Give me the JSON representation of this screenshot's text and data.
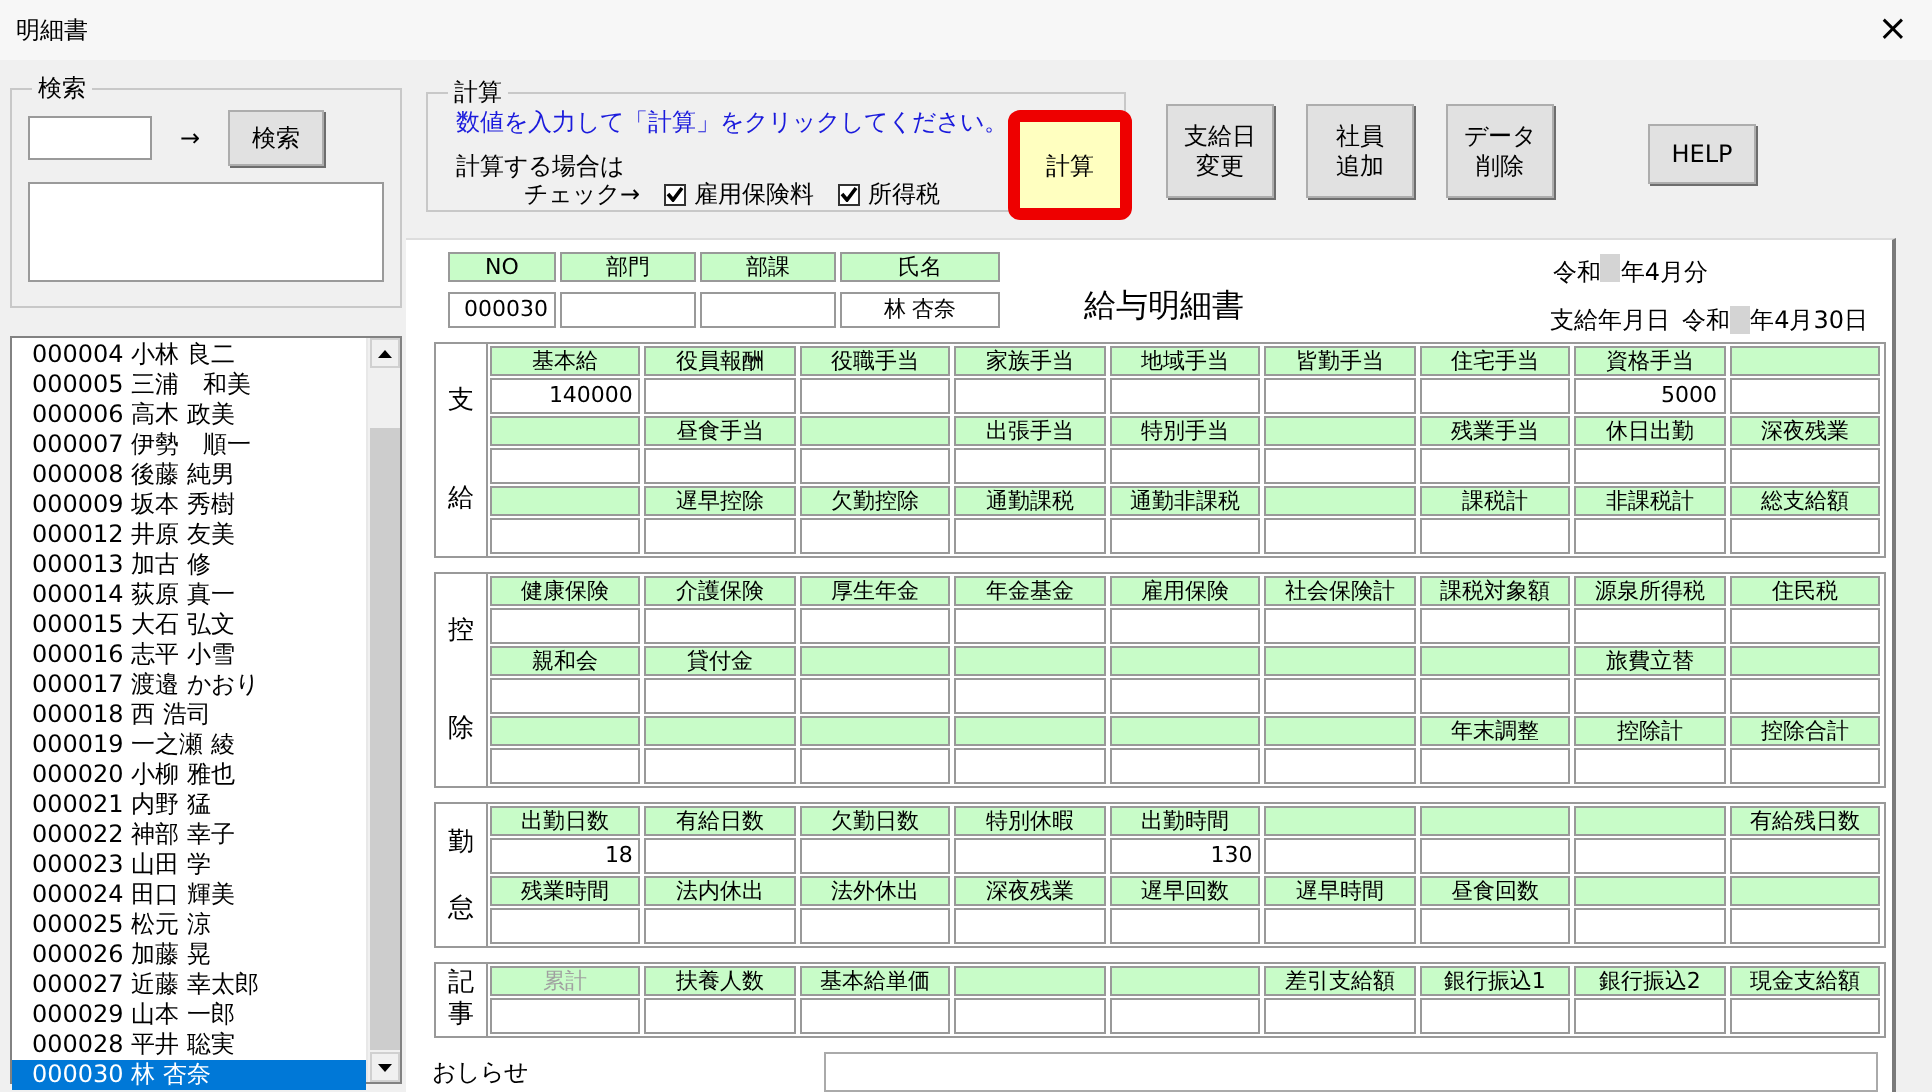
{
  "window": {
    "title": "明細書",
    "close": "×"
  },
  "search": {
    "title": "検索",
    "arrow": "→",
    "button": "検索"
  },
  "employee_list": {
    "items": [
      {
        "label": "000004 小林 良二",
        "selected": false
      },
      {
        "label": "000005 三浦　和美",
        "selected": false
      },
      {
        "label": "000006 高木 政美",
        "selected": false
      },
      {
        "label": "000007 伊勢　順一",
        "selected": false
      },
      {
        "label": "000008 後藤 純男",
        "selected": false
      },
      {
        "label": "000009 坂本 秀樹",
        "selected": false
      },
      {
        "label": "000012 井原 友美",
        "selected": false
      },
      {
        "label": "000013 加古 修",
        "selected": false
      },
      {
        "label": "000014 荻原 真一",
        "selected": false
      },
      {
        "label": "000015 大石 弘文",
        "selected": false
      },
      {
        "label": "000016 志平 小雪",
        "selected": false
      },
      {
        "label": "000017 渡邉 かおり",
        "selected": false
      },
      {
        "label": "000018 西 浩司",
        "selected": false
      },
      {
        "label": "000019 一之瀬 綾",
        "selected": false
      },
      {
        "label": "000020 小柳 雅也",
        "selected": false
      },
      {
        "label": "000021 内野 猛",
        "selected": false
      },
      {
        "label": "000022 神部 幸子",
        "selected": false
      },
      {
        "label": "000023 山田 学",
        "selected": false
      },
      {
        "label": "000024 田口 輝美",
        "selected": false
      },
      {
        "label": "000025 松元 涼",
        "selected": false
      },
      {
        "label": "000026 加藤 晃",
        "selected": false
      },
      {
        "label": "000027 近藤 幸太郎",
        "selected": false
      },
      {
        "label": "000029 山本 一郎",
        "selected": false
      },
      {
        "label": "000028 平井 聡実",
        "selected": false
      },
      {
        "label": "000030 林 杏奈",
        "selected": true
      }
    ]
  },
  "calculation": {
    "title": "計算",
    "instruction": "数値を入力して「計算」をクリックしてください。",
    "prompt_line1": "計算する場合は",
    "prompt_line2": "チェック→",
    "options": [
      {
        "label": "雇用保険料",
        "checked": true
      },
      {
        "label": "所得税",
        "checked": true
      }
    ],
    "button": "計算"
  },
  "toolbar_buttons": [
    {
      "lines": [
        "支給日",
        "変更"
      ]
    },
    {
      "lines": [
        "社員",
        "追加"
      ]
    },
    {
      "lines": [
        "データ",
        "削除"
      ]
    },
    {
      "lines": [
        "HELP"
      ]
    }
  ],
  "header": {
    "columns": [
      {
        "label": "NO",
        "value": "000030"
      },
      {
        "label": "部門"
      },
      {
        "label": "部課"
      },
      {
        "label": "氏名",
        "value": "林 杏奈"
      }
    ]
  },
  "document_title": "給与明細書",
  "period": {
    "prefix": "令和",
    "suffix": "年4月分"
  },
  "pay_date": {
    "label": "支給年月日",
    "prefix": "令和",
    "suffix": "年4月30日"
  },
  "sections": [
    {
      "label": "支給",
      "rows": [
        [
          {
            "label": "基本給",
            "value": "140000",
            "disabled": false
          },
          {
            "label": "役員報酬",
            "disabled": false
          },
          {
            "label": "役職手当",
            "disabled": false
          },
          {
            "label": "家族手当",
            "disabled": false
          },
          {
            "label": "地域手当",
            "disabled": false
          },
          {
            "label": "皆勤手当",
            "disabled": false
          },
          {
            "label": "住宅手当",
            "disabled": false
          },
          {
            "label": "資格手当",
            "value": "5000",
            "disabled": false
          },
          {}
        ],
        [
          {},
          {
            "label": "昼食手当",
            "disabled": false
          },
          {},
          {
            "label": "出張手当",
            "disabled": false
          },
          {
            "label": "特別手当",
            "disabled": false
          },
          {},
          {
            "label": "残業手当",
            "disabled": false
          },
          {
            "label": "休日出勤",
            "disabled": false
          },
          {
            "label": "深夜残業",
            "disabled": false
          }
        ],
        [
          {},
          {
            "label": "遅早控除",
            "disabled": false
          },
          {
            "label": "欠勤控除",
            "disabled": false
          },
          {
            "label": "通勤課税",
            "disabled": false
          },
          {
            "label": "通勤非課税",
            "disabled": false
          },
          {},
          {
            "label": "課税計",
            "disabled": false
          },
          {
            "label": "非課税計",
            "disabled": false
          },
          {
            "label": "総支給額",
            "disabled": false
          }
        ]
      ]
    },
    {
      "label": "控除",
      "rows": [
        [
          {
            "label": "健康保険",
            "disabled": false
          },
          {
            "label": "介護保険",
            "disabled": false
          },
          {
            "label": "厚生年金",
            "disabled": false
          },
          {
            "label": "年金基金",
            "disabled": false
          },
          {
            "label": "雇用保険",
            "disabled": false
          },
          {
            "label": "社会保険計",
            "disabled": false
          },
          {
            "label": "課税対象額",
            "disabled": false
          },
          {
            "label": "源泉所得税",
            "disabled": false
          },
          {
            "label": "住民税",
            "disabled": false
          }
        ],
        [
          {
            "label": "親和会",
            "disabled": false
          },
          {
            "label": "貸付金",
            "disabled": false
          },
          {},
          {},
          {},
          {},
          {},
          {
            "label": "旅費立替",
            "disabled": false
          },
          {}
        ],
        [
          {},
          {},
          {},
          {},
          {},
          {},
          {
            "label": "年末調整",
            "disabled": false
          },
          {
            "label": "控除計",
            "disabled": false
          },
          {
            "label": "控除合計",
            "disabled": false
          }
        ]
      ]
    },
    {
      "label": "勤怠",
      "rows": [
        [
          {
            "label": "出勤日数",
            "value": "18",
            "disabled": false
          },
          {
            "label": "有給日数",
            "disabled": false
          },
          {
            "label": "欠勤日数",
            "disabled": false
          },
          {
            "label": "特別休暇",
            "disabled": false
          },
          {
            "label": "出勤時間",
            "value": "130",
            "disabled": false
          },
          {},
          {},
          {},
          {
            "label": "有給残日数",
            "disabled": false
          }
        ],
        [
          {
            "label": "残業時間",
            "disabled": false
          },
          {
            "label": "法内休出",
            "disabled": false
          },
          {
            "label": "法外休出",
            "disabled": false
          },
          {
            "label": "深夜残業",
            "disabled": false
          },
          {
            "label": "遅早回数",
            "disabled": false
          },
          {
            "label": "遅早時間",
            "disabled": false
          },
          {
            "label": "昼食回数",
            "disabled": false
          },
          {},
          {}
        ]
      ]
    },
    {
      "label": "記事",
      "rows": [
        [
          {
            "label": "累計",
            "disabled": true
          },
          {
            "label": "扶養人数",
            "disabled": false
          },
          {
            "label": "基本給単価",
            "disabled": false
          },
          {},
          {},
          {
            "label": "差引支給額",
            "disabled": false
          },
          {
            "label": "銀行振込1",
            "disabled": false
          },
          {
            "label": "銀行振込2",
            "disabled": false
          },
          {
            "label": "現金支給額",
            "disabled": false
          }
        ]
      ]
    }
  ],
  "notice": {
    "label": "おしらせ"
  }
}
